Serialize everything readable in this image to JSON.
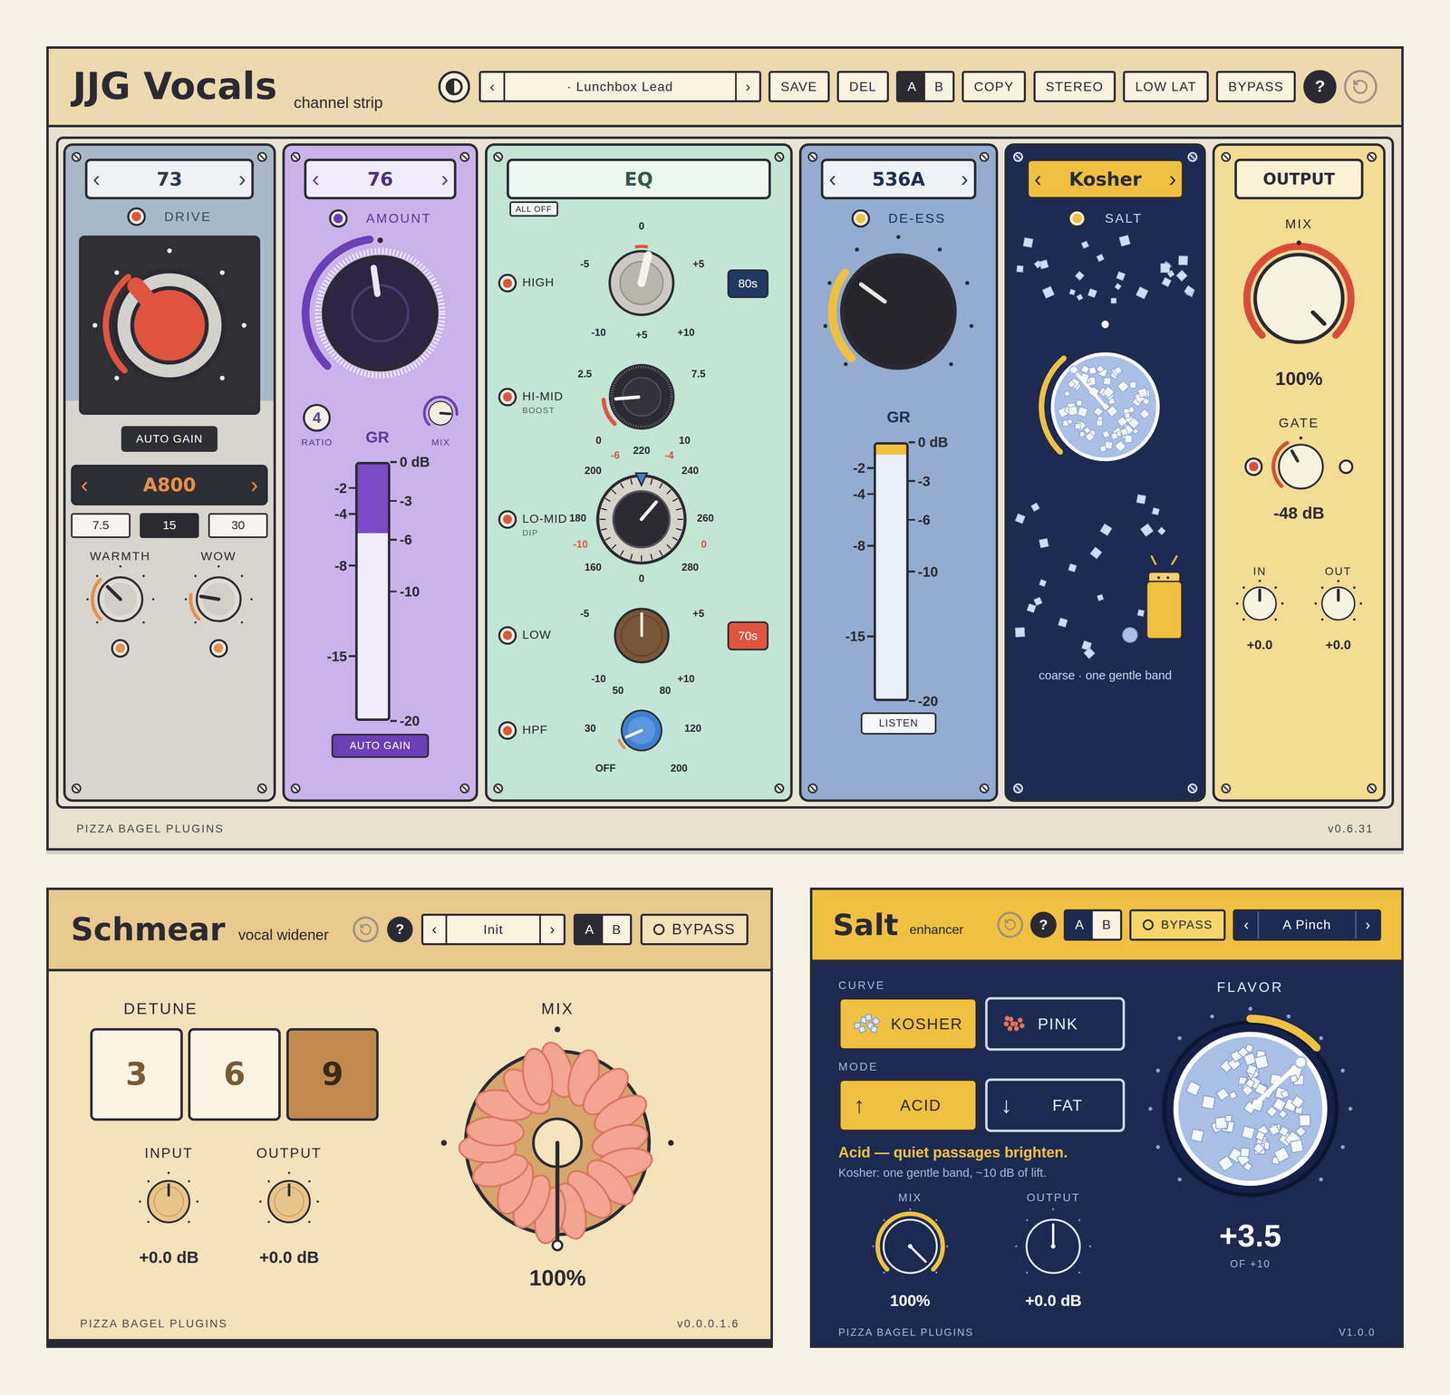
{
  "channel_strip": {
    "title": "JJG Vocals",
    "subtitle": "channel strip",
    "preset": {
      "prev": "‹",
      "name": "· Lunchbox Lead",
      "next": "›"
    },
    "file_buttons": [
      {
        "label": "SAVE"
      },
      {
        "label": "DEL"
      }
    ],
    "ab": [
      {
        "label": "A",
        "selected": true
      },
      {
        "label": "B",
        "selected": false
      }
    ],
    "toggles": [
      {
        "label": "COPY",
        "on": false
      },
      {
        "label": "STEREO",
        "on": false
      },
      {
        "label": "LOW LAT",
        "on": false
      },
      {
        "label": "BYPASS",
        "on": false
      }
    ],
    "help": "?",
    "comp73": {
      "selector": {
        "prev": "‹",
        "name": "73",
        "next": "›"
      },
      "drive": {
        "label": "DRIVE",
        "on": true,
        "level": 0.35
      },
      "auto_gain": {
        "label": "AUTO GAIN",
        "on": false
      },
      "tape": {
        "prev": "‹",
        "name": "A800",
        "next": "›"
      },
      "speeds": [
        {
          "label": "7.5",
          "selected": false
        },
        {
          "label": "15",
          "selected": true
        },
        {
          "label": "30",
          "selected": false
        }
      ],
      "knobs": [
        {
          "label": "WARMTH",
          "level": 0.33,
          "on": true
        },
        {
          "label": "WOW",
          "level": 0.2,
          "on": true
        }
      ]
    },
    "comp76": {
      "selector": {
        "prev": "‹",
        "name": "76",
        "next": "›"
      },
      "amount": {
        "label": "AMOUNT",
        "on": true,
        "level": 0.47
      },
      "ratio": {
        "label": "RATIO",
        "value": "4"
      },
      "mix": {
        "label": "MIX",
        "level": 0.85
      },
      "gr": {
        "label": "GR",
        "level": 0.27,
        "scale_left": [
          "-2",
          "-4",
          "-8",
          "-15"
        ],
        "scale_right": [
          "0 dB",
          "-3",
          "-6",
          "-10",
          "-20"
        ]
      },
      "auto_gain": {
        "label": "AUTO GAIN",
        "on": true
      }
    },
    "eq": {
      "title": "EQ",
      "all_off": "ALL OFF",
      "bands": [
        {
          "kind": "silver",
          "label": "HIGH",
          "on": true,
          "level": 0.55,
          "marks": [
            {
              "text": "0",
              "color": "#2b2a33"
            },
            {
              "text": "-5",
              "color": "#2b2a33"
            },
            {
              "text": "+5",
              "color": "#2b2a33"
            },
            {
              "text": "-10",
              "color": "#2b2a33"
            },
            {
              "text": "+5",
              "color": "#2b2a33"
            },
            {
              "text": "+10",
              "color": "#2b2a33"
            }
          ],
          "badge": {
            "label": "80s",
            "color": "#1f3a63"
          }
        },
        {
          "kind": "black",
          "label": "HI-MID",
          "sub": "BOOST",
          "on": true,
          "level": 0.15,
          "marks": [
            {
              "text": "2.5",
              "color": "#2b2a33"
            },
            {
              "text": "7.5",
              "color": "#2b2a33"
            },
            {
              "text": "0",
              "color": "#2b2a33"
            },
            {
              "text": "10",
              "color": "#2b2a33"
            },
            {
              "text": "-6",
              "color": "#e0553f"
            },
            {
              "text": "220",
              "color": "#2b2a33"
            },
            {
              "text": "-4",
              "color": "#e0553f"
            }
          ],
          "badge": null
        },
        {
          "kind": "dial",
          "label": "LO-MID",
          "sub": "DIP",
          "on": true,
          "level": 0.65,
          "dip_level": 0.5,
          "marks": [
            {
              "text": "200",
              "color": "#2b2a33"
            },
            {
              "text": "240",
              "color": "#2b2a33"
            },
            {
              "text": "180",
              "color": "#2b2a33"
            },
            {
              "text": "260",
              "color": "#2b2a33"
            },
            {
              "text": "-10",
              "color": "#e0553f"
            },
            {
              "text": "0",
              "color": "#e0553f"
            },
            {
              "text": "160",
              "color": "#2b2a33"
            },
            {
              "text": "280",
              "color": "#2b2a33"
            }
          ],
          "badge": null
        },
        {
          "kind": "brown",
          "label": "LOW",
          "on": true,
          "level": 0.5,
          "marks": [
            {
              "text": "0",
              "color": "#2b2a33"
            },
            {
              "text": "-5",
              "color": "#2b2a33"
            },
            {
              "text": "+5",
              "color": "#2b2a33"
            },
            {
              "text": "-10",
              "color": "#2b2a33"
            },
            {
              "text": "50",
              "color": "#2b2a33"
            },
            {
              "text": "80",
              "color": "#2b2a33"
            },
            {
              "text": "+10",
              "color": "#2b2a33"
            }
          ],
          "badge": {
            "label": "70s",
            "color": "#e0553f"
          }
        },
        {
          "kind": "blue",
          "label": "HPF",
          "on": true,
          "level": 0.08,
          "marks": [
            {
              "text": "30",
              "color": "#2b2a33"
            },
            {
              "text": "120",
              "color": "#2b2a33"
            },
            {
              "text": "OFF",
              "color": "#2b2a33"
            },
            {
              "text": "200",
              "color": "#2b2a33"
            }
          ],
          "badge": null
        }
      ]
    },
    "deess": {
      "selector": {
        "prev": "‹",
        "name": "536A",
        "next": "›"
      },
      "deess": {
        "label": "DE-ESS",
        "on": true,
        "level": 0.3
      },
      "gr": {
        "label": "GR",
        "level": 0.04,
        "scale_left": [
          "-2",
          "-4",
          "-8",
          "-15"
        ],
        "scale_right": [
          "0 dB",
          "-3",
          "-6",
          "-10",
          "-20"
        ]
      },
      "listen": {
        "label": "LISTEN",
        "on": false
      }
    },
    "salt_module": {
      "selector": {
        "prev": "‹",
        "name": "Kosher",
        "next": "›"
      },
      "salt": {
        "label": "SALT",
        "on": true,
        "level": 0.35
      },
      "caption": "coarse · one gentle band"
    },
    "output": {
      "title": "OUTPUT",
      "mix": {
        "label": "MIX",
        "level": 1,
        "reading": "100%"
      },
      "gate": {
        "label": "GATE",
        "on": true,
        "level": 0.39,
        "reading": "-48 dB",
        "sidechain_on": false
      },
      "trims": [
        {
          "label": "IN",
          "level": 0.5,
          "reading": "+0.0"
        },
        {
          "label": "OUT",
          "level": 0.5,
          "reading": "+0.0"
        }
      ]
    },
    "footer": "PIZZA BAGEL PLUGINS",
    "version": "v0.6.31"
  },
  "schmear": {
    "title": "Schmear",
    "subtitle": "vocal widener",
    "help": "?",
    "preset": {
      "prev": "‹",
      "name": "Init",
      "next": "›"
    },
    "ab": [
      {
        "label": "A",
        "selected": true
      },
      {
        "label": "B",
        "selected": false
      }
    ],
    "bypass": {
      "label": "BYPASS",
      "on": false
    },
    "detune": {
      "label": "DETUNE",
      "options": [
        {
          "label": "3",
          "selected": false
        },
        {
          "label": "6",
          "selected": false
        },
        {
          "label": "9",
          "selected": true
        }
      ]
    },
    "trims": [
      {
        "label": "INPUT",
        "level": 0.5,
        "reading": "+0.0 dB"
      },
      {
        "label": "OUTPUT",
        "level": 0.5,
        "reading": "+0.0 dB"
      }
    ],
    "mix": {
      "label": "MIX",
      "level": 1,
      "reading": "100%"
    },
    "footer": "PIZZA BAGEL PLUGINS",
    "version": "v0.0.0.1.6"
  },
  "salt": {
    "title": "Salt",
    "subtitle": "enhancer",
    "help": "?",
    "ab": [
      {
        "label": "A",
        "selected": true
      },
      {
        "label": "B",
        "selected": false
      }
    ],
    "bypass": {
      "label": "BYPASS",
      "on": false
    },
    "preset": {
      "prev": "‹",
      "name": "A Pinch",
      "next": "›"
    },
    "curve": {
      "label": "CURVE",
      "options": [
        {
          "label": "KOSHER",
          "kind": "crystal",
          "selected": true
        },
        {
          "label": "PINK",
          "kind": "pink",
          "selected": false
        }
      ]
    },
    "mode": {
      "label": "MODE",
      "options": [
        {
          "label": "ACID",
          "icon": "↑",
          "selected": true
        },
        {
          "label": "FAT",
          "icon": "↓",
          "selected": false
        }
      ]
    },
    "description": "Acid — quiet passages brighten.",
    "note": "Kosher: one gentle band, ~10 dB of lift.",
    "mix": {
      "label": "MIX",
      "level": 1,
      "reading": "100%"
    },
    "output": {
      "label": "OUTPUT",
      "level": 0.5,
      "reading": "+0.0 dB"
    },
    "flavor": {
      "label": "FLAVOR",
      "level": 0.675,
      "reading": "+3.5",
      "max": "OF +10"
    },
    "footer": "PIZZA BAGEL PLUGINS",
    "version": "V1.0.0"
  }
}
